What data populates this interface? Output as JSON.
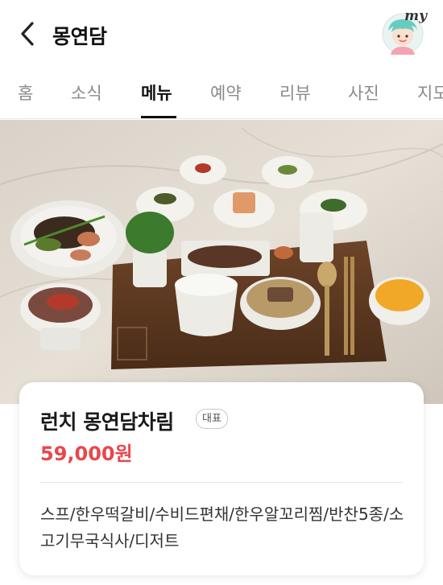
{
  "header": {
    "title": "몽연담",
    "avatar_label": "my"
  },
  "tabs": [
    {
      "label": "홈",
      "active": false
    },
    {
      "label": "소식",
      "active": false
    },
    {
      "label": "메뉴",
      "active": true
    },
    {
      "label": "예약",
      "active": false
    },
    {
      "label": "리뷰",
      "active": false
    },
    {
      "label": "사진",
      "active": false
    },
    {
      "label": "지도",
      "active": false
    }
  ],
  "menu_item": {
    "name": "런치 몽연담차림",
    "badge": "대표",
    "price": "59,000원",
    "description": "스프/한우떡갈비/수비드편채/한우알꼬리찜/반찬5종/소고기무국식사/디저트"
  },
  "colors": {
    "price": "#e8474c",
    "active_tab": "#111111",
    "inactive_tab": "#8a8a8a"
  }
}
